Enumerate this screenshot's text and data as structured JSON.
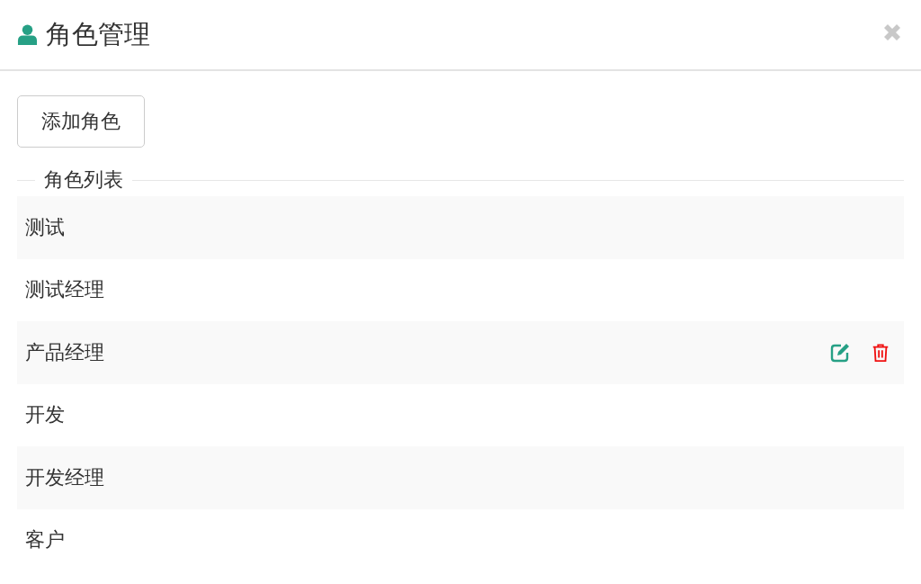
{
  "dialog": {
    "title": "角色管理"
  },
  "add_button": {
    "label": "添加角色"
  },
  "list": {
    "legend": "角色列表",
    "rows": [
      {
        "name": "测试",
        "hovered": false
      },
      {
        "name": "测试经理",
        "hovered": false
      },
      {
        "name": "产品经理",
        "hovered": true
      },
      {
        "name": "开发",
        "hovered": false
      },
      {
        "name": "开发经理",
        "hovered": false
      },
      {
        "name": "客户",
        "hovered": false
      }
    ]
  }
}
